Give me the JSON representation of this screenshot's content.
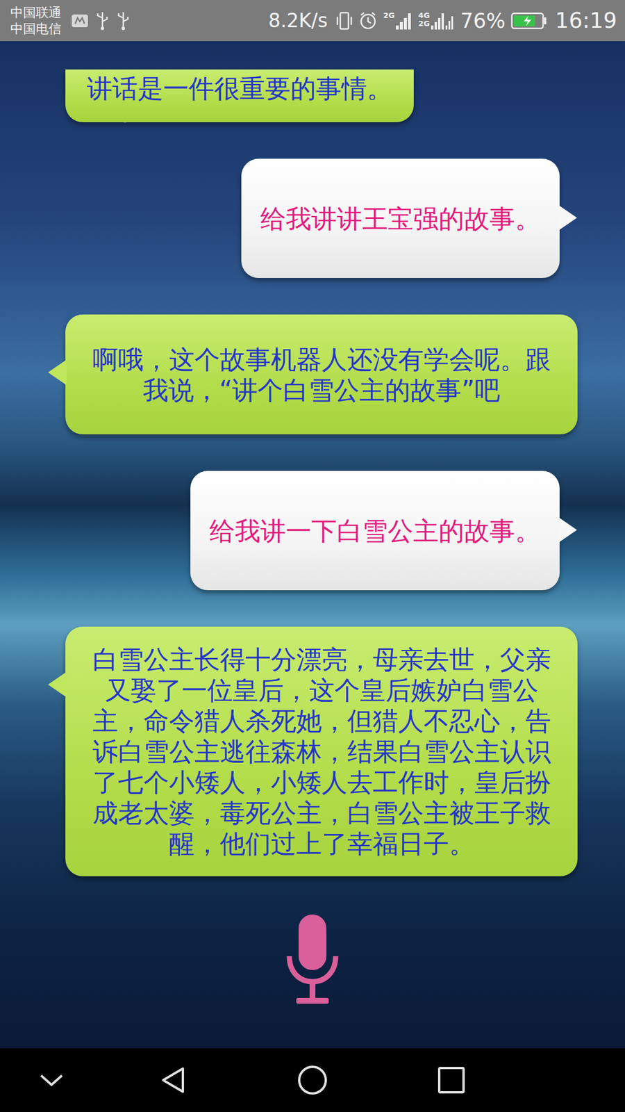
{
  "status_bar": {
    "carriers": [
      "中国联通",
      "中国电信"
    ],
    "speed": "8.2K/s",
    "signal_1": {
      "labels": [
        "2G"
      ]
    },
    "signal_2": {
      "labels": [
        "4G",
        "2G"
      ]
    },
    "battery": {
      "percent": "76%",
      "level": 0.76,
      "charging": true
    },
    "time": "16:19"
  },
  "messages": [
    {
      "kind": "robot",
      "clipped": true,
      "text": "讲话是一件很重要的事情。"
    },
    {
      "kind": "user",
      "clipped": false,
      "text": "给我讲讲王宝强的故事。"
    },
    {
      "kind": "robot",
      "clipped": false,
      "text": "啊哦，这个故事机器人还没有学会呢。跟我说，“讲个白雪公主的故事”吧"
    },
    {
      "kind": "user",
      "clipped": false,
      "text": "给我讲一下白雪公主的故事。"
    },
    {
      "kind": "robot",
      "clipped": false,
      "text": "白雪公主长得十分漂亮，母亲去世，父亲又娶了一位皇后，这个皇后嫉妒白雪公主，命令猎人杀死她，但猎人不忍心，告诉白雪公主逃往森林，结果白雪公主认识了七个小矮人，小矮人去工作时，皇后扮成老太婆，毒死公主，白雪公主被王子救醒，他们过上了幸福日子。"
    }
  ]
}
